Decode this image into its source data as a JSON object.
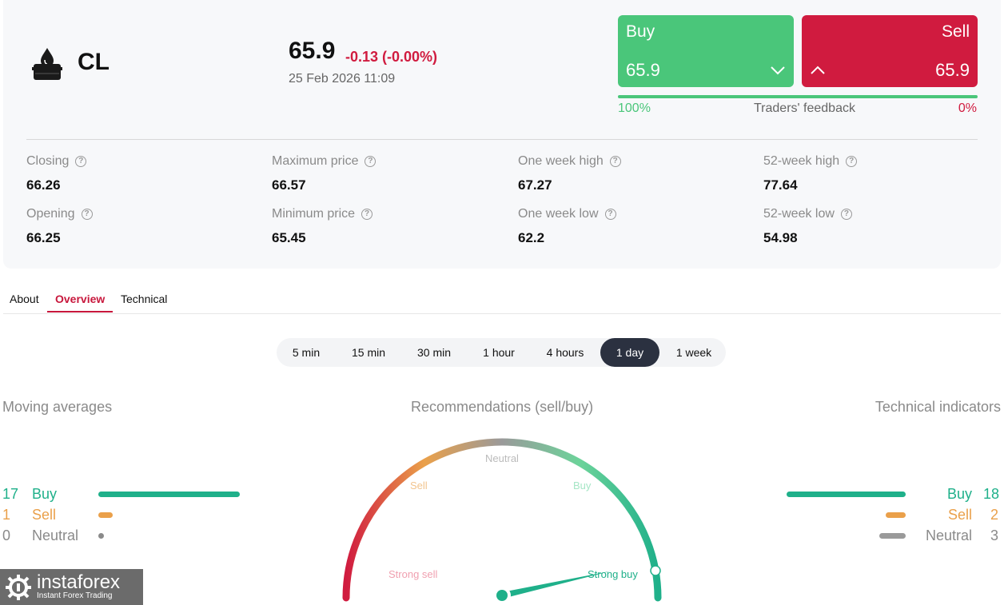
{
  "instrument": {
    "ticker": "CL",
    "icon": "oil-drop-icon",
    "price": "65.9",
    "change": "-0.13 (-0.00%)",
    "datetime": "25 Feb 2026 11:09"
  },
  "trade": {
    "buy_label": "Buy",
    "buy_value": "65.9",
    "sell_label": "Sell",
    "sell_value": "65.9",
    "feedback_title": "Traders' feedback",
    "buy_percent": "100%",
    "sell_percent": "0%",
    "buy_fraction": 1.0
  },
  "stats": [
    {
      "label": "Closing",
      "value": "66.26"
    },
    {
      "label": "Maximum price",
      "value": "66.57"
    },
    {
      "label": "One week high",
      "value": "67.27"
    },
    {
      "label": "52-week high",
      "value": "77.64"
    },
    {
      "label": "Opening",
      "value": "66.25"
    },
    {
      "label": "Minimum price",
      "value": "65.45"
    },
    {
      "label": "One week low",
      "value": "62.2"
    },
    {
      "label": "52-week low",
      "value": "54.98"
    }
  ],
  "tabs": [
    {
      "label": "About"
    },
    {
      "label": "Overview",
      "active": true
    },
    {
      "label": "Technical"
    }
  ],
  "timeframes": [
    {
      "label": "5 min"
    },
    {
      "label": "15 min"
    },
    {
      "label": "30 min"
    },
    {
      "label": "1 hour"
    },
    {
      "label": "4 hours"
    },
    {
      "label": "1 day",
      "active": true
    },
    {
      "label": "1 week"
    }
  ],
  "moving_averages": {
    "title": "Moving averages",
    "buy": {
      "count": "17",
      "label": "Buy"
    },
    "sell": {
      "count": "1",
      "label": "Sell"
    },
    "neutral": {
      "count": "0",
      "label": "Neutral"
    }
  },
  "recommendations": {
    "title": "Recommendations (sell/buy)",
    "labels": {
      "strong_sell": "Strong sell",
      "sell": "Sell",
      "neutral": "Neutral",
      "buy": "Buy",
      "strong_buy": "Strong buy"
    },
    "needle_value": 0.93
  },
  "technical_indicators": {
    "title": "Technical indicators",
    "buy": {
      "count": "18",
      "label": "Buy"
    },
    "sell": {
      "count": "2",
      "label": "Sell"
    },
    "neutral": {
      "count": "3",
      "label": "Neutral"
    }
  },
  "colors": {
    "buy": "#4ac67a",
    "sell": "#d01b3f",
    "teal": "#1fb08a",
    "orange": "#eaa04a",
    "gray": "#8a8a8a",
    "accent": "#c8173c",
    "active_timeframe": "#2b3140"
  },
  "logo": {
    "brand": "instaforex",
    "tagline": "Instant Forex Trading",
    "icon": "gear-logo-icon"
  }
}
